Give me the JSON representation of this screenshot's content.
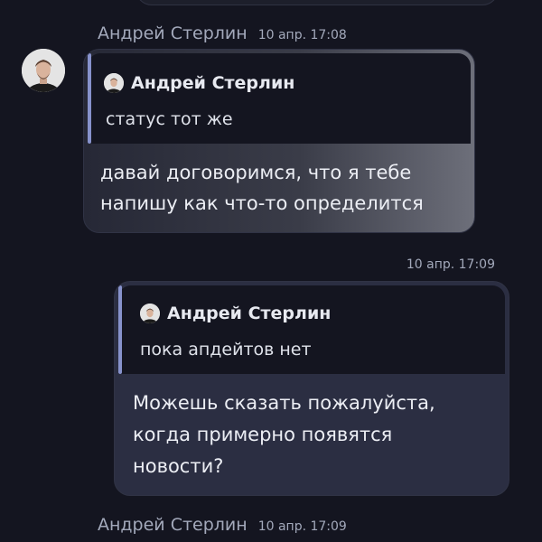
{
  "messages": [
    {
      "sender": "Андрей Стерлин",
      "time": "10 апр. 17:08",
      "reply": {
        "author": "Андрей Стерлин",
        "text": "статус тот же"
      },
      "lines": [
        "давай договоримся, что я тебе",
        "напишу как что-то определится"
      ]
    },
    {
      "time": "10 апр. 17:09",
      "reply": {
        "author": "Андрей Стерлин",
        "text": "пока апдейтов нет"
      },
      "lines": [
        "Можешь сказать пожалуйста,",
        "когда примерно появятся",
        "новости?"
      ]
    },
    {
      "sender": "Андрей Стерлин",
      "time": "10 апр. 17:09"
    }
  ],
  "icons": {
    "avatar": "user-photo-icon"
  },
  "colors": {
    "background": "#141520",
    "outgoing_bubble": "#2b2e42",
    "reply_accent": "#8792cc",
    "muted_text": "#a3a9bb"
  }
}
